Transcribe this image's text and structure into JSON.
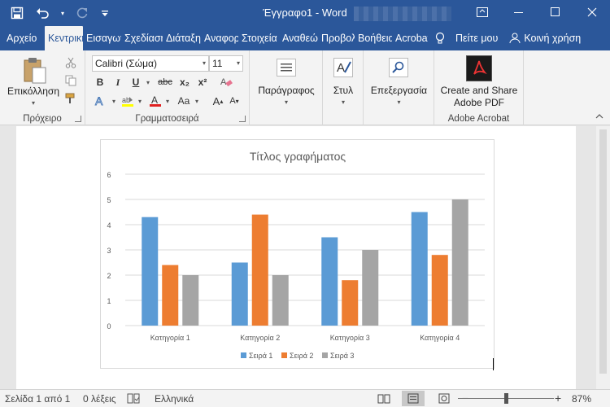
{
  "window": {
    "doc_title": "Έγγραφο1",
    "separator": "-",
    "app_name": "Word"
  },
  "tabs": [
    {
      "label": "Αρχείο"
    },
    {
      "label": "Κεντρική"
    },
    {
      "label": "Εισαγωγή"
    },
    {
      "label": "Σχεδίαση"
    },
    {
      "label": "Διάταξη"
    },
    {
      "label": "Αναφορές"
    },
    {
      "label": "Στοιχεία"
    },
    {
      "label": "Αναθεώρηση"
    },
    {
      "label": "Προβολή"
    },
    {
      "label": "Βοήθεια"
    },
    {
      "label": "Acrobat"
    }
  ],
  "tell_me": "Πείτε μου",
  "share": "Κοινή χρήση",
  "ribbon": {
    "clipboard": {
      "paste": "Επικόλληση",
      "label": "Πρόχειρο"
    },
    "font": {
      "name": "Calibri (Σώμα)",
      "size": "11",
      "label": "Γραμματοσειρά",
      "bold": "B",
      "italic": "I",
      "underline": "U",
      "strike": "abc",
      "sub": "x₂",
      "sup": "x²",
      "case": "Aa",
      "grow": "A",
      "shrink": "A"
    },
    "paragraph": {
      "label": "Παράγραφος"
    },
    "styles": {
      "label": "Στυλ"
    },
    "editing": {
      "label": "Επεξεργασία"
    },
    "acrobat": {
      "line1": "Create and Share",
      "line2": "Adobe PDF",
      "label": "Adobe Acrobat"
    }
  },
  "chart_data": {
    "type": "bar",
    "title": "Τίτλος γραφήματος",
    "categories": [
      "Κατηγορία 1",
      "Κατηγορία 2",
      "Κατηγορία 3",
      "Κατηγορία 4"
    ],
    "series": [
      {
        "name": "Σειρά 1",
        "color": "#5b9bd5",
        "values": [
          4.3,
          2.5,
          3.5,
          4.5
        ]
      },
      {
        "name": "Σειρά 2",
        "color": "#ed7d31",
        "values": [
          2.4,
          4.4,
          1.8,
          2.8
        ]
      },
      {
        "name": "Σειρά 3",
        "color": "#a5a5a5",
        "values": [
          2,
          2,
          3,
          5
        ]
      }
    ],
    "ylim": [
      0,
      6
    ],
    "yticks": [
      0,
      1,
      2,
      3,
      4,
      5,
      6
    ],
    "grid": true,
    "legend": "bottom"
  },
  "status": {
    "page": "Σελίδα 1 από 1",
    "words": "0 λέξεις",
    "language": "Ελληνικά",
    "zoom": "87%"
  },
  "colors": {
    "brand": "#2b579a"
  }
}
